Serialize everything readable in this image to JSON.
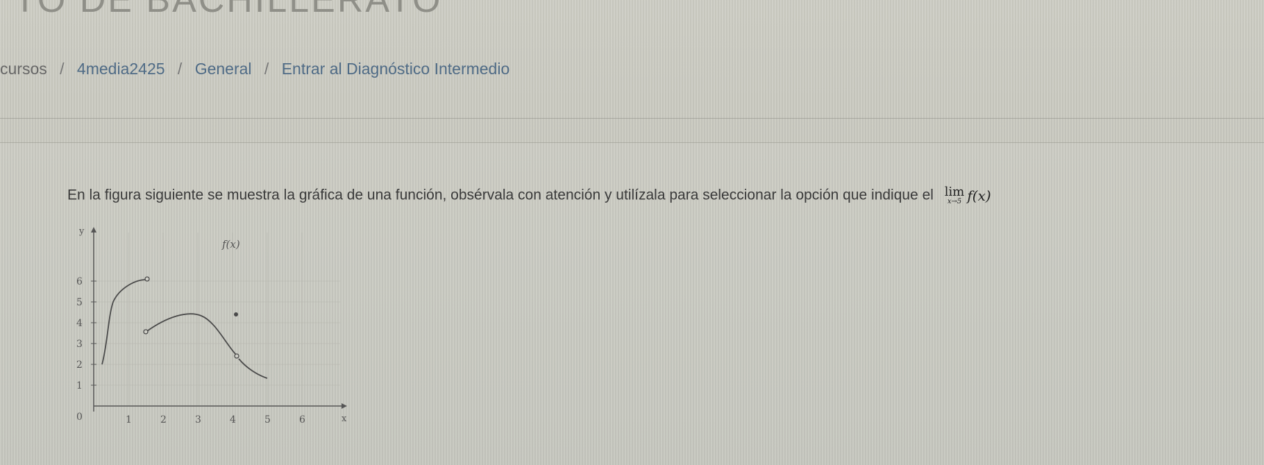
{
  "header": {
    "course_title": "TO DE BACHILLERATO"
  },
  "breadcrumb": {
    "separator": "/",
    "items": [
      {
        "label": "cursos"
      },
      {
        "label": "4media2425"
      },
      {
        "label": "General"
      },
      {
        "label": "Entrar al Diagnóstico Intermedio"
      }
    ]
  },
  "question": {
    "text": "En la figura siguiente se muestra la gráfica de una función, obsérvala con atención y utilízala para seleccionar la opción que indique el",
    "limit": {
      "lim": "lim",
      "sub": "x→5",
      "expr": "f(x)"
    }
  },
  "graph": {
    "function_label": "f(x)",
    "y_axis_label": "y",
    "x_axis_label": "x",
    "origin_label": "0",
    "x_ticks": [
      "1",
      "2",
      "3",
      "4",
      "5",
      "6"
    ],
    "y_ticks": [
      "1",
      "2",
      "3",
      "4",
      "5",
      "6"
    ],
    "colors": {
      "axis": "#555555",
      "grid": "#b5b5ad",
      "curve": "#4a4a4a"
    }
  }
}
